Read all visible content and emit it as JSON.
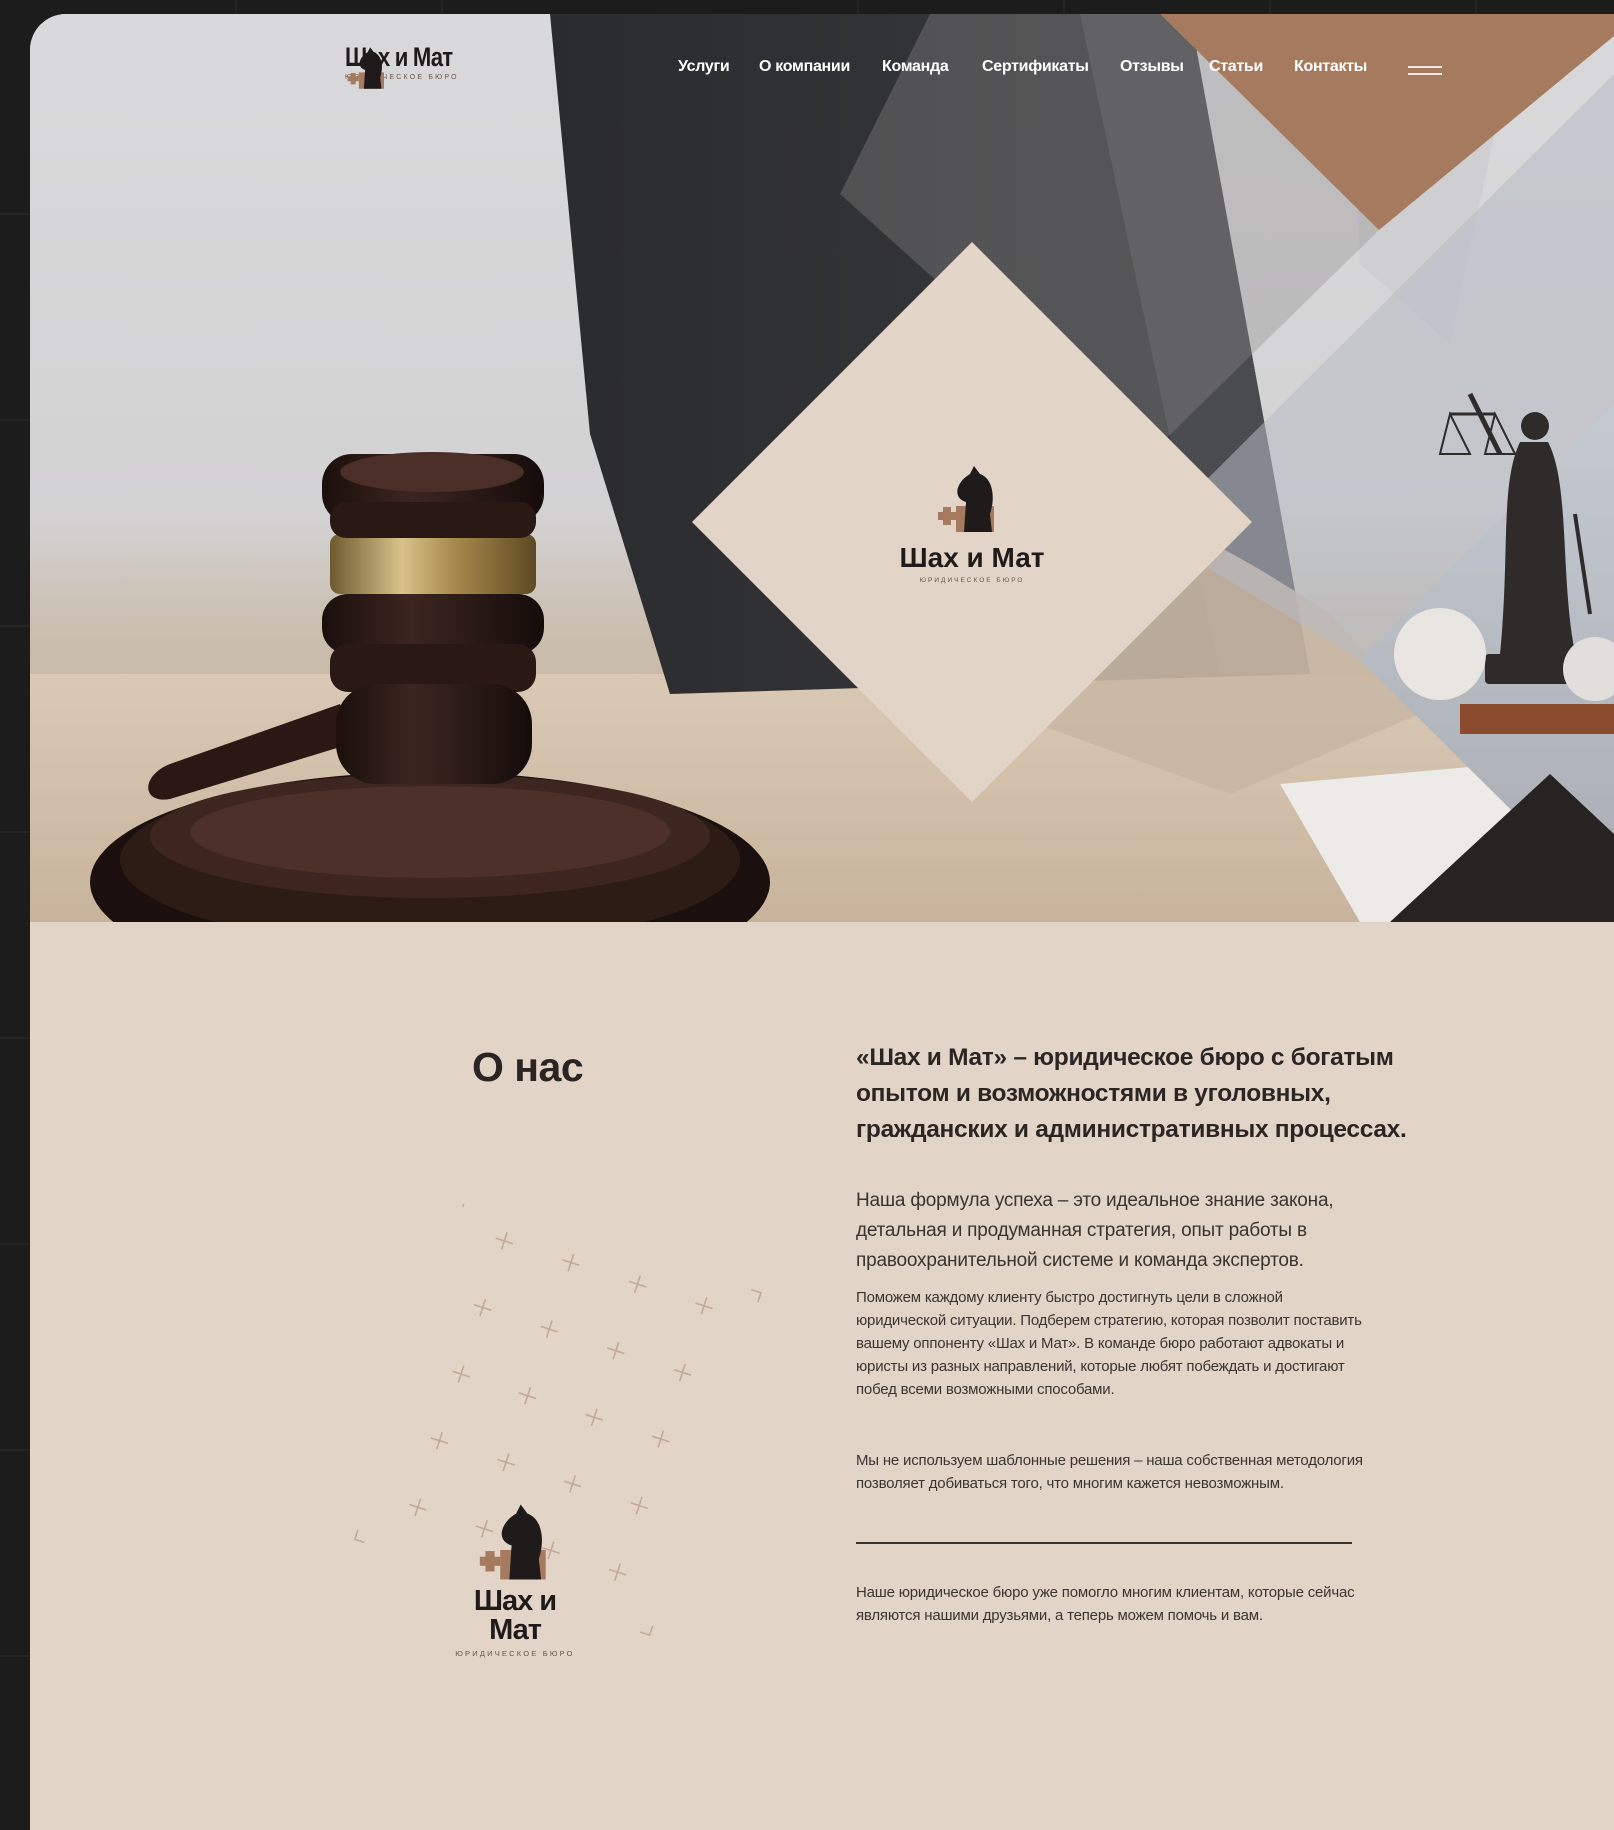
{
  "brand": {
    "name": "Шах и Мат",
    "tagline": "ЮРИДИЧЕСКОЕ БЮРО"
  },
  "nav": {
    "items": [
      {
        "label": "Услуги"
      },
      {
        "label": "О компании"
      },
      {
        "label": "Команда"
      },
      {
        "label": "Сертификаты"
      },
      {
        "label": "Отзывы"
      },
      {
        "label": "Статьи"
      },
      {
        "label": "Контакты"
      }
    ],
    "menu_icon": "hamburger-menu-icon"
  },
  "hero": {
    "images": [
      "judge-gavel-photo",
      "lady-justice-statue-photo"
    ]
  },
  "about": {
    "title": "О нас",
    "lead": "«Шах и Мат» – юридическое бюро с богатым опытом и возможностями в уголовных, гражданских и административных процессах.",
    "p1": "Наша формула успеха – это идеальное знание закона, детальная и продуманная стратегия, опыт работы в правоохранительной системе и команда экспертов.",
    "p2": "Поможем каждому клиенту быстро достигнуть цели в сложной юридической ситуации. Подберем стратегию, которая позволит поставить вашему оппоненту «Шах и Мат». В команде бюро работают адвокаты и юристы из разных направлений, которые любят побеждать и достигают побед всеми возможными способами.",
    "p3": "Мы не используем шаблонные решения – наша собственная методология позволяет добиваться того, что многим кажется невозможным.",
    "p4": "Наше юридическое бюро уже помогло многим клиентам, которые сейчас являются нашими друзьями, а теперь можем помочь и вам."
  },
  "colors": {
    "accent_brown": "#a57a5e",
    "beige": "#e3d4c8",
    "dark": "#1f1b1a",
    "page_bg": "#1c1c1c"
  }
}
